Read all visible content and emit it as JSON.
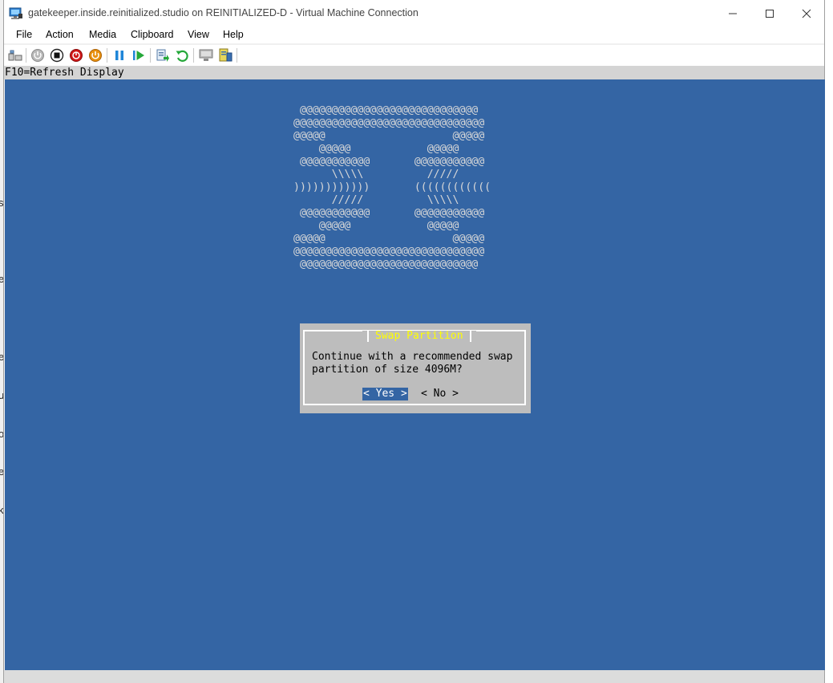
{
  "window": {
    "title": "gatekeeper.inside.reinitialized.studio on REINITIALIZED-D - Virtual Machine Connection",
    "controls": [
      "—",
      "☐",
      "✕"
    ]
  },
  "menu": {
    "items": [
      "File",
      "Action",
      "Media",
      "Clipboard",
      "View",
      "Help"
    ]
  },
  "toolbar": {
    "icons": [
      "ctrl-alt-del-icon",
      "start-icon",
      "turn-off-icon",
      "shutdown-icon",
      "power-icon",
      "pause-icon",
      "resume-icon",
      "checkpoint-icon",
      "revert-icon",
      "basic-session-icon",
      "enhanced-session-icon"
    ]
  },
  "hint": {
    "text": "F10=Refresh Display"
  },
  "console": {
    "ascii_art": " @@@@@@@@@@@@@@@@@@@@@@@@@@@@\n@@@@@@@@@@@@@@@@@@@@@@@@@@@@@@\n@@@@@                    @@@@@\n    @@@@@            @@@@@\n @@@@@@@@@@@       @@@@@@@@@@@\n      \\\\\\\\\\          /////\n))))))))))))       ((((((((((((\n      /////          \\\\\\\\\\\n @@@@@@@@@@@       @@@@@@@@@@@\n    @@@@@            @@@@@\n@@@@@                    @@@@@\n@@@@@@@@@@@@@@@@@@@@@@@@@@@@@@\n @@@@@@@@@@@@@@@@@@@@@@@@@@@@",
    "ascii_color": "#d8d8d8",
    "background": "#3465a4"
  },
  "dialog": {
    "title": "Swap Partition",
    "message": "Continue with a recommended swap\npartition of size 4096M?",
    "yes_label": "< Yes >",
    "no_label": "< No >",
    "title_color": "#ffff00"
  },
  "background_window": {
    "fragments": [
      "s",
      "e",
      "e",
      "u",
      "o",
      "e",
      "k"
    ]
  }
}
